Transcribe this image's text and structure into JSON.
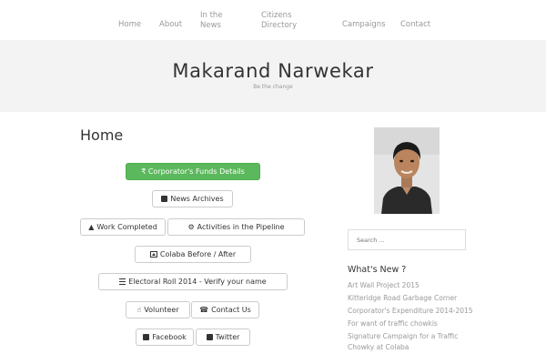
{
  "nav": {
    "items": [
      {
        "label": "Home"
      },
      {
        "label": "About"
      },
      {
        "label": "In the\nNews"
      },
      {
        "label": "Citizens\nDirectory"
      },
      {
        "label": "Campaigns"
      },
      {
        "label": "Contact"
      }
    ]
  },
  "header": {
    "site_title": "Makarand Narwekar",
    "tagline": "Be the change"
  },
  "main": {
    "page_title": "Home",
    "buttons": {
      "funds": "₹ Corporator's Funds Details",
      "news_archives": "News Archives",
      "work_completed": "Work Completed",
      "activities": "Activities in the Pipeline",
      "colaba": "Colaba Before / After",
      "electoral": "Electoral Roll 2014 - Verify your name",
      "volunteer": "Volunteer",
      "contact_us": "Contact Us",
      "facebook": "Facebook",
      "twitter": "Twitter"
    },
    "colors": {
      "success": "#5cb85c"
    }
  },
  "sidebar": {
    "search_placeholder": "Search ...",
    "widget_title": "What's New ?",
    "news": [
      {
        "label": "Art Wall Project 2015"
      },
      {
        "label": "Kitteridge Road Garbage Corner"
      },
      {
        "label": "Corporator's Expenditure 2014-2015"
      },
      {
        "label": "For want of traffic chowkis"
      },
      {
        "label": "Signature Campaign for a Traffic\nChowky at Colaba"
      }
    ]
  }
}
